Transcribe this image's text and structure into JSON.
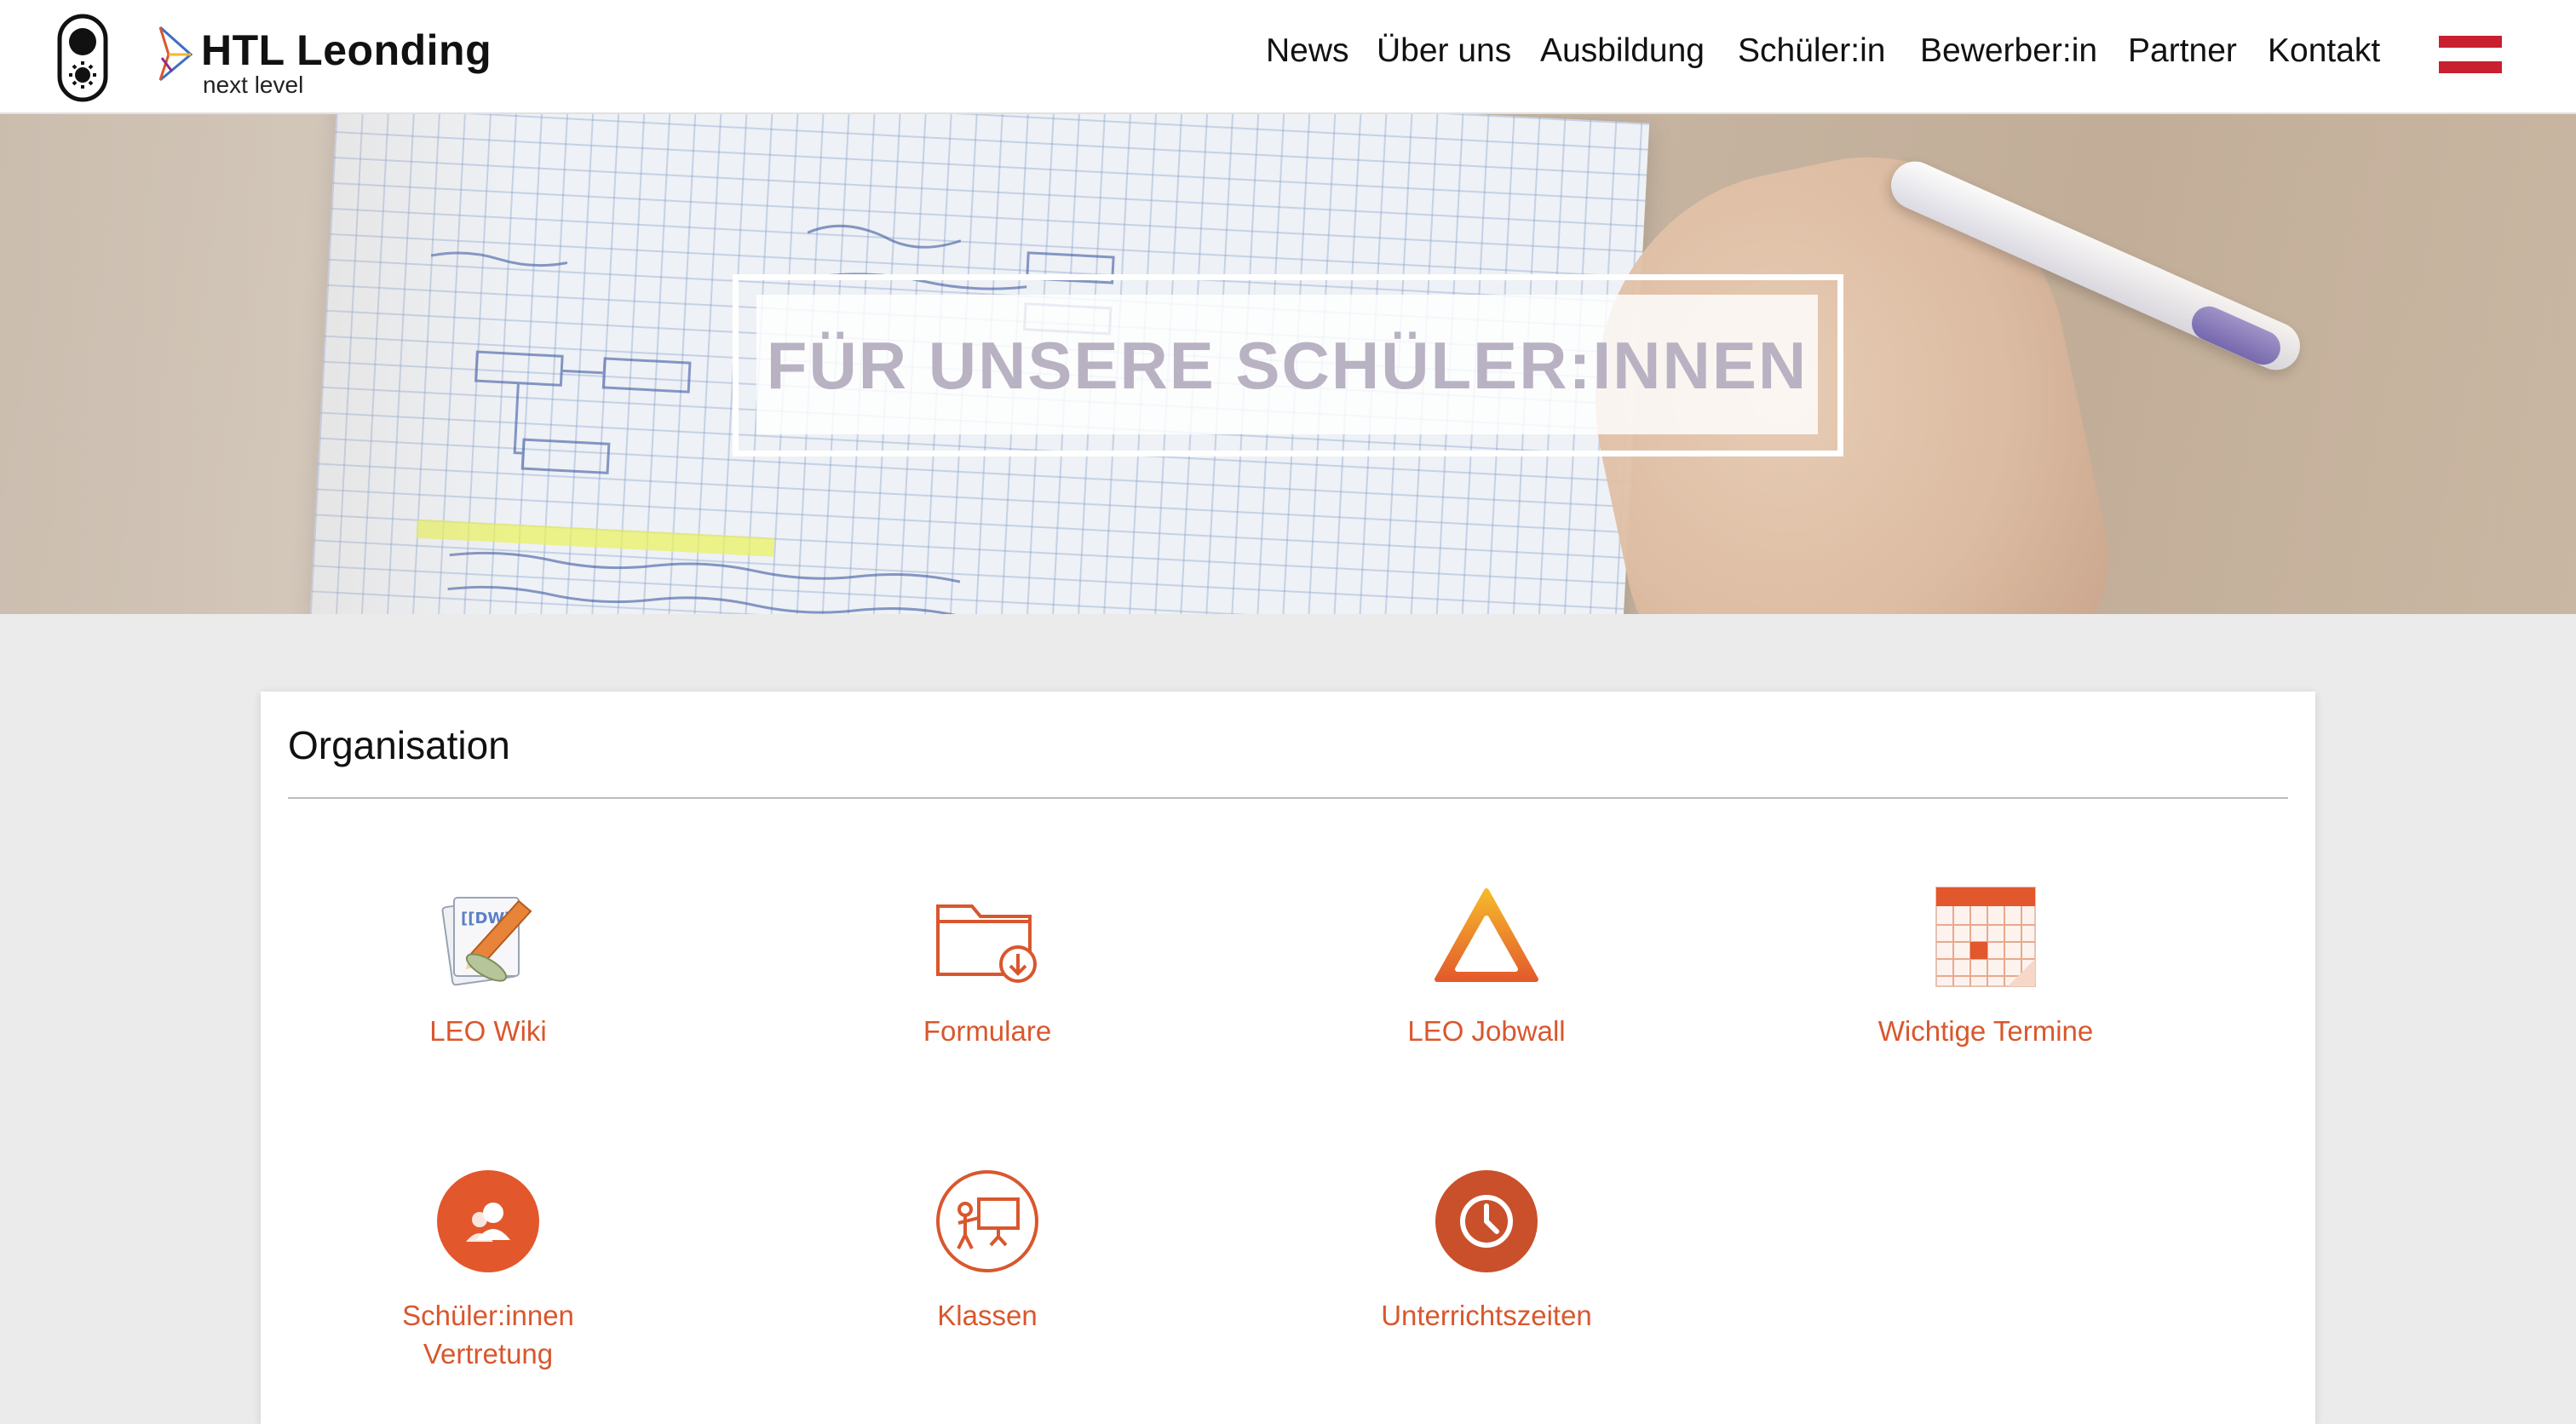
{
  "header": {
    "brand_title": "HTL Leonding",
    "brand_subtitle": "next level",
    "nav": [
      "News",
      "Über uns",
      "Ausbildung",
      "Schüler:in",
      "Bewerber:in",
      "Partner",
      "Kontakt"
    ],
    "flag_colors": [
      "#c8202f",
      "#ffffff",
      "#c8202f"
    ]
  },
  "hero": {
    "title": "FÜR UNSERE SCHÜLER:INNEN"
  },
  "organisation": {
    "heading": "Organisation",
    "accent_color": "#d9572d",
    "tiles": [
      {
        "label": "LEO Wiki",
        "icon": "wiki-icon"
      },
      {
        "label": "Formulare",
        "icon": "folder-download-icon"
      },
      {
        "label": "LEO Jobwall",
        "icon": "triangle-icon"
      },
      {
        "label": "Wichtige Termine",
        "icon": "calendar-icon"
      },
      {
        "label": "Schüler:innen Vertretung",
        "icon": "people-icon"
      },
      {
        "label": "Klassen",
        "icon": "presentation-icon"
      },
      {
        "label": "Unterrichtszeiten",
        "icon": "clock-icon"
      }
    ]
  }
}
